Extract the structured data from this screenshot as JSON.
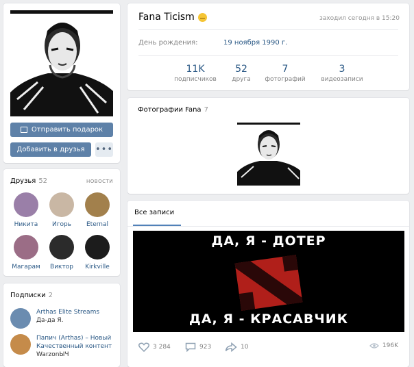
{
  "profile": {
    "name": "Fana Ticism",
    "last_seen": "заходил сегодня в 15:20",
    "birthday_label": "День рождения:",
    "birthday_value": "19 ноября 1990 г.",
    "counters": [
      {
        "value": "11K",
        "label": "подписчиков"
      },
      {
        "value": "52",
        "label": "друга"
      },
      {
        "value": "7",
        "label": "фотографий"
      },
      {
        "value": "3",
        "label": "видеозаписи"
      }
    ]
  },
  "actions": {
    "gift_label": "Отправить подарок",
    "add_friend_label": "Добавить в друзья",
    "more_label": "•••"
  },
  "friends": {
    "title": "Друзья",
    "count": "52",
    "news_label": "НОВОСТИ",
    "items": [
      {
        "name": "Никита",
        "color": "#9a7fa8"
      },
      {
        "name": "Игорь",
        "color": "#c9b7a4"
      },
      {
        "name": "Eternal",
        "color": "#a2804c"
      },
      {
        "name": "Магарам",
        "color": "#9b6d86"
      },
      {
        "name": "Виктор",
        "color": "#2b2b2b"
      },
      {
        "name": "Kirkville",
        "color": "#1c1c1c"
      }
    ]
  },
  "subscriptions": {
    "title": "Подписки",
    "count": "2",
    "items": [
      {
        "title": "Arthas Elite Streams",
        "desc": "Да-да Я.",
        "color": "#6b8cb0"
      },
      {
        "title": "Папич (Arthas) – Новый Качественный контент",
        "desc": "WarzonЫЧ",
        "color": "#c58b4a"
      }
    ]
  },
  "photos": {
    "title": "Фотографии Fana",
    "count": "7"
  },
  "wall": {
    "tab_label": "Все записи",
    "post_line1": "ДА, Я - ДОТЕР",
    "post_line2": "ДА, Я - КРАСАВЧИК",
    "likes": "3 284",
    "comments": "923",
    "shares": "10",
    "views": "196K"
  },
  "colors": {
    "link": "#2a5885",
    "button": "#5e81a8",
    "dota_red": "#b01f1a"
  }
}
